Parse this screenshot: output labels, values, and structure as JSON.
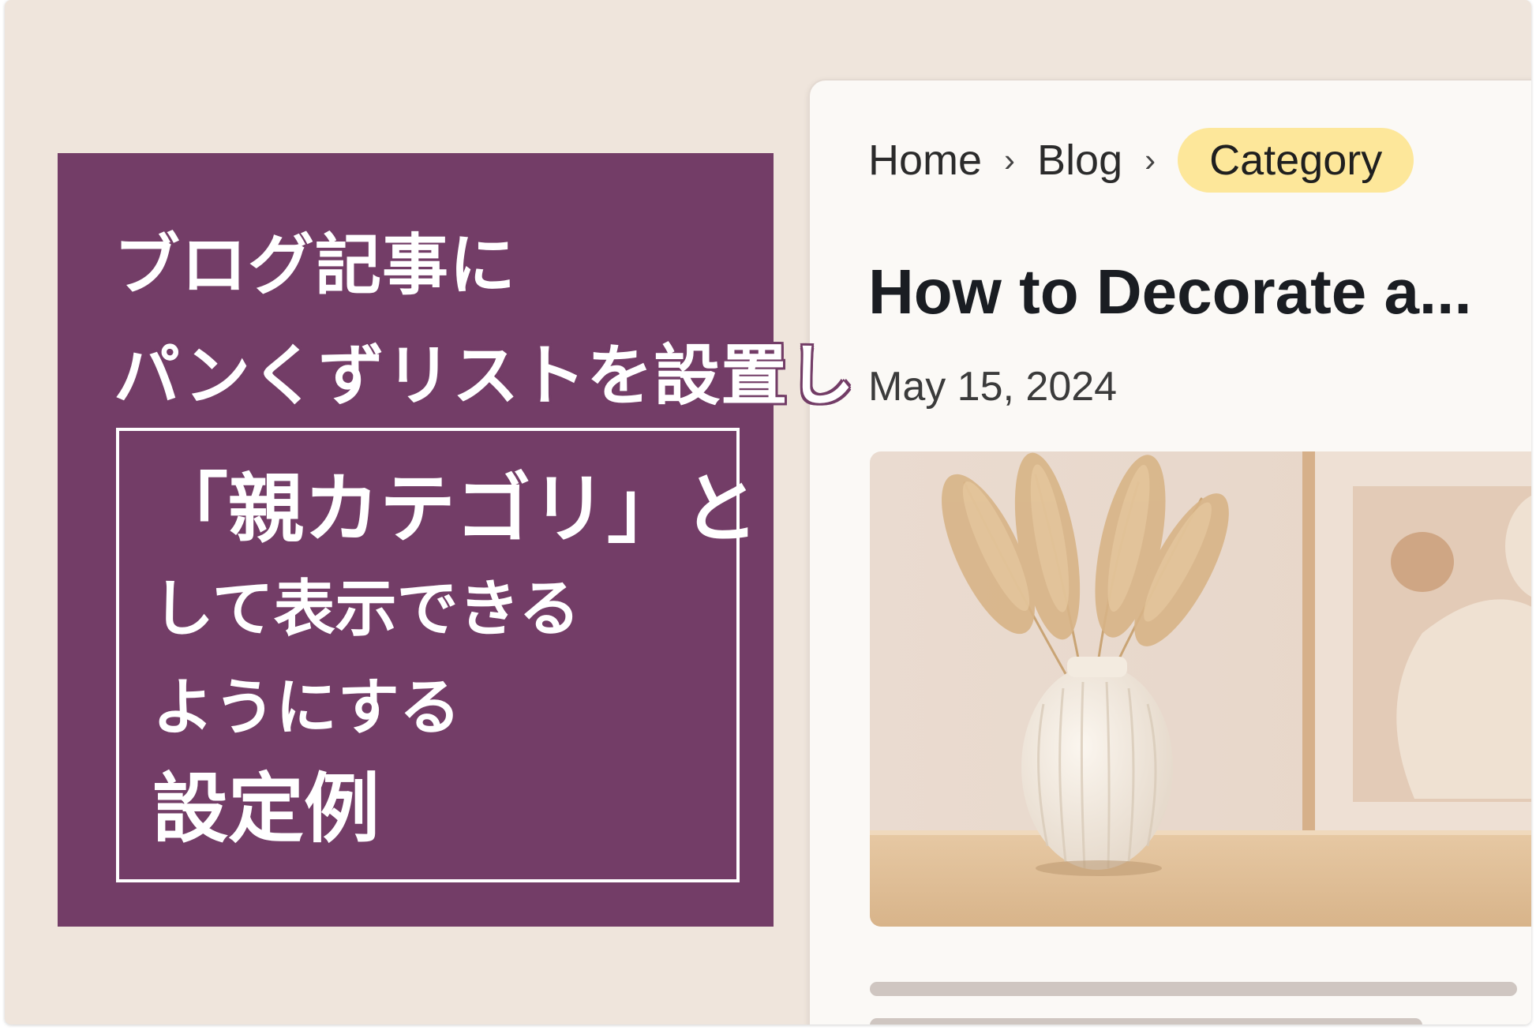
{
  "promo": {
    "title_line1": "ブログ記事に",
    "title_line2": "パンくずリストを設置し",
    "box_line1": "「親カテゴリ」と",
    "box_line2": "して表示できる",
    "box_line3": "ようにする",
    "box_line4": "設定例"
  },
  "breadcrumb": {
    "items": [
      "Home",
      "Blog",
      "Category"
    ],
    "separator": "›",
    "active_bg": "#fde79a"
  },
  "post": {
    "title": "How to Decorate a...",
    "date": "May 15, 2024",
    "image_icon": "vase-photo"
  },
  "colors": {
    "background": "#efe5dc",
    "promo_panel": "#733d67",
    "card": "#fbf9f6",
    "text": "#1a1d22"
  }
}
